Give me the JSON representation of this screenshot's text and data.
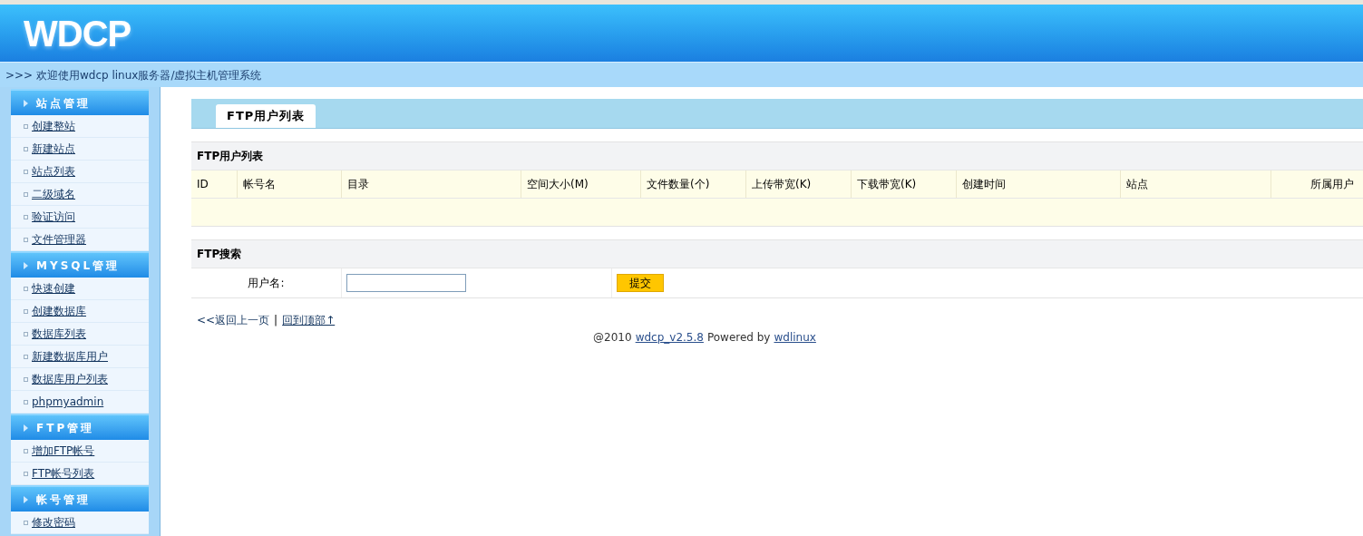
{
  "header": {
    "logo": "WDCP"
  },
  "breadcrumb": ">>> 欢迎使用wdcp linux服务器/虚拟主机管理系统",
  "sidebar": [
    {
      "title": "站点管理",
      "items": [
        "创建整站",
        "新建站点",
        "站点列表",
        "二级域名",
        "验证访问",
        "文件管理器"
      ]
    },
    {
      "title": "MYSQL管理",
      "items": [
        "快速创建",
        "创建数据库",
        "数据库列表",
        "新建数据库用户",
        "数据库用户列表",
        "phpmyadmin"
      ]
    },
    {
      "title": "FTP管理",
      "items": [
        "增加FTP帐号",
        "FTP帐号列表"
      ]
    },
    {
      "title": "帐号管理",
      "items": [
        "修改密码"
      ]
    }
  ],
  "tabs": [
    {
      "label": "FTP用户列表",
      "selected": true
    }
  ],
  "table": {
    "title": "FTP用户列表",
    "columns": [
      "ID",
      "帐号名",
      "目录",
      "空间大小(M)",
      "文件数量(个)",
      "上传带宽(K)",
      "下载带宽(K)",
      "创建时间",
      "站点",
      "所属用户"
    ]
  },
  "search": {
    "title": "FTP搜索",
    "label": "用户名:",
    "button": "提交"
  },
  "nav_links": {
    "back": "<<返回上一页",
    "separator": "|",
    "top": "回到顶部↑"
  },
  "footer": {
    "copyright": "@2010",
    "version_link": "wdcp_v2.5.8",
    "powered": "Powered by",
    "author_link": "wdlinux"
  }
}
